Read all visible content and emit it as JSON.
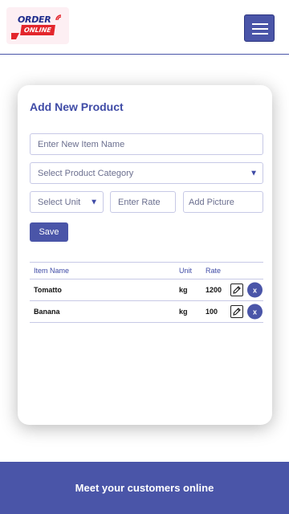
{
  "logo": {
    "line1": "ORDER",
    "line2": "ONLINE"
  },
  "form": {
    "title": "Add New Product",
    "item_name_placeholder": "Enter New Item Name",
    "category_placeholder": "Select Product Category",
    "unit_placeholder": "Select Unit",
    "rate_placeholder": "Enter Rate",
    "picture_placeholder": "Add Picture",
    "save_label": "Save"
  },
  "table": {
    "headers": {
      "name": "Item Name",
      "unit": "Unit",
      "rate": "Rate"
    },
    "rows": [
      {
        "name": "Tomatto",
        "unit": "kg",
        "rate": "1200",
        "delete": "x"
      },
      {
        "name": "Banana",
        "unit": "kg",
        "rate": "100",
        "delete": "x"
      }
    ]
  },
  "footer": {
    "tagline": "Meet your customers online"
  },
  "colors": {
    "accent": "#4a55a8",
    "brand_red": "#e3262c",
    "brand_blue": "#1e2c8c"
  },
  "icons": {
    "menu": "hamburger-icon",
    "edit": "pencil-icon",
    "delete": "close-icon",
    "dropdown": "caret-down-icon"
  }
}
